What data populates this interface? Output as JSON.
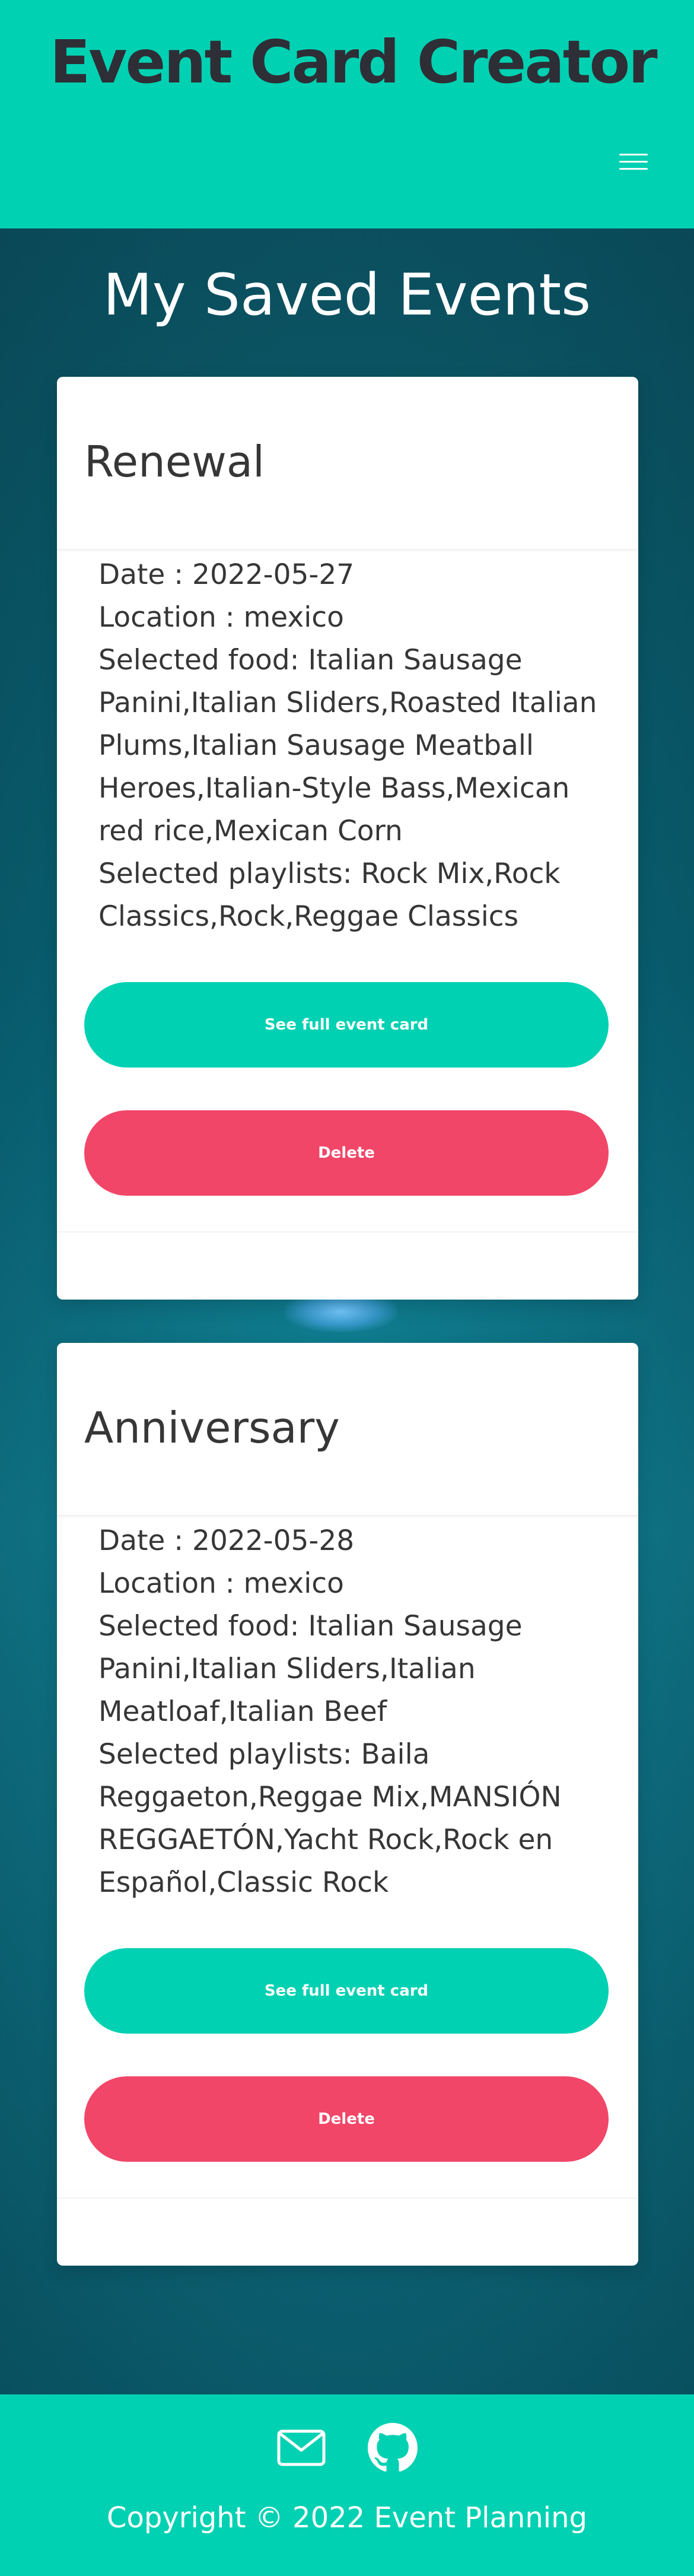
{
  "header": {
    "brand": "Event Card Creator",
    "menu_icon": "hamburger-menu-icon"
  },
  "main": {
    "title": "My Saved Events",
    "events": [
      {
        "name": "Renewal",
        "date": "Date : 2022-05-27",
        "location": "Location : mexico",
        "food": "Selected food: Italian Sausage Panini,Italian Sliders,Roasted Italian Plums,Italian Sausage Meatball Heroes,Italian-Style Bass,Mexican red rice,Mexican Corn",
        "playlists": "Selected playlists: Rock Mix,Rock Classics,Rock,Reggae Classics",
        "view_label": "See full event card",
        "delete_label": "Delete"
      },
      {
        "name": "Anniversary",
        "date": "Date : 2022-05-28",
        "location": "Location : mexico",
        "food": "Selected food: Italian Sausage Panini,Italian Sliders,Italian Meatloaf,Italian Beef",
        "playlists": "Selected playlists: Baila Reggaeton,Reggae Mix,MANSIÓN REGGAETÓN,Yacht Rock,Rock en Español,Classic Rock",
        "view_label": "See full event card",
        "delete_label": "Delete"
      }
    ]
  },
  "footer": {
    "icons": [
      "email-icon",
      "github-icon"
    ],
    "copyright": "Copyright © 2022 Event Planning"
  },
  "colors": {
    "primary": "#00d1b2",
    "danger": "#f14668",
    "text": "#363636",
    "brand_text": "#2e2e36",
    "background": "#0c5a6b"
  }
}
